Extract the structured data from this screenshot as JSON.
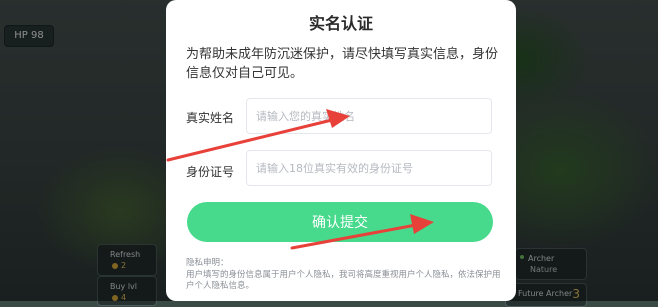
{
  "game": {
    "hp_label": "HP 98",
    "cards": {
      "refresh": {
        "label": "Refresh",
        "cost": "2"
      },
      "buy": {
        "label": "Buy lvl",
        "cost": "4"
      },
      "archer": {
        "label": "Archer",
        "sub": "Nature"
      },
      "future_archer": {
        "label": "Future Archer",
        "cost": "3"
      }
    }
  },
  "modal": {
    "title": "实名认证",
    "description": "为帮助未成年防沉迷保护，请尽快填写真实信息，身份信息仅对自己可见。",
    "name_label": "真实姓名",
    "name_placeholder": "请输入您的真实姓名",
    "id_label": "身份证号",
    "id_placeholder": "请输入18位真实有效的身份证号",
    "submit_label": "确认提交",
    "privacy_heading": "隐私申明：",
    "privacy_text": "用户填写的身份信息属于用户个人隐私，我司将高度重视用户个人隐私，依法保护用户个人隐私信息。"
  },
  "colors": {
    "accent": "#47d98c",
    "annotation_arrow": "#e8413a"
  }
}
